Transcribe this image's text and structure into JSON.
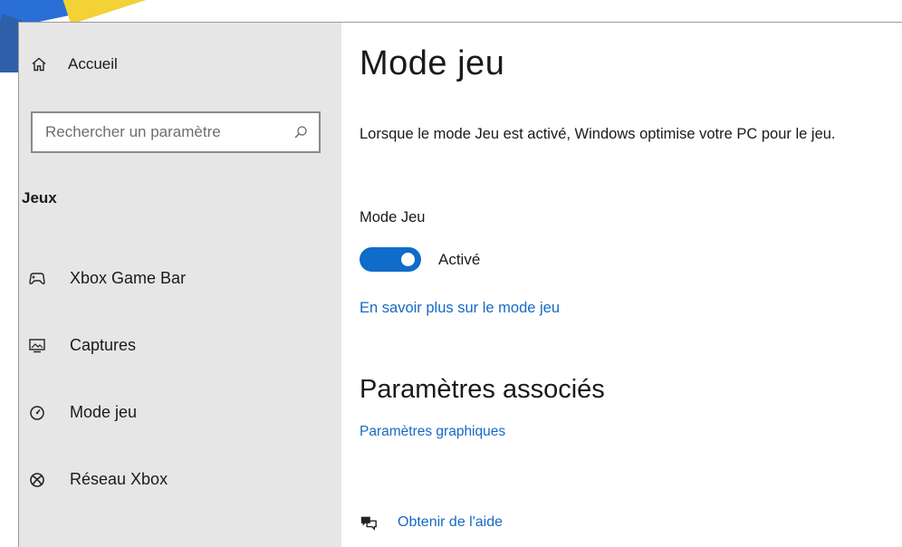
{
  "sidebar": {
    "home_label": "Accueil",
    "search_placeholder": "Rechercher un paramètre",
    "section_title": "Jeux",
    "items": [
      {
        "label": "Xbox Game Bar",
        "icon": "xbox-game-bar-icon"
      },
      {
        "label": "Captures",
        "icon": "captures-icon"
      },
      {
        "label": "Mode jeu",
        "icon": "game-mode-icon"
      },
      {
        "label": "Réseau Xbox",
        "icon": "xbox-icon"
      }
    ]
  },
  "main": {
    "title": "Mode jeu",
    "description": "Lorsque le mode Jeu est activé, Windows optimise votre PC pour le jeu.",
    "toggle_label": "Mode Jeu",
    "toggle_state": "Activé",
    "toggle_on": true,
    "learn_more_link": "En savoir plus sur le mode jeu",
    "related_title": "Paramètres associés",
    "graphics_link": "Paramètres graphiques",
    "help_link": "Obtenir de l'aide"
  },
  "colors": {
    "accent": "#0f6cc9",
    "link": "#1669c4",
    "sidebar_bg": "#e6e6e6"
  }
}
